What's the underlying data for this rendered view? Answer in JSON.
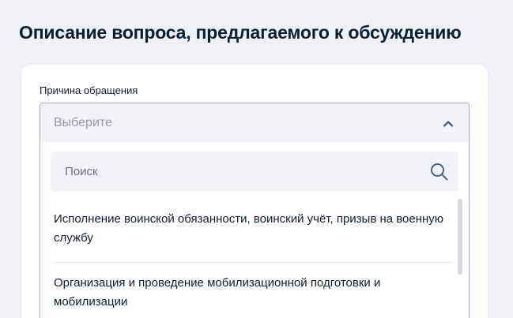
{
  "page": {
    "title": "Описание вопроса, предлагаемого к обсуждению"
  },
  "form": {
    "reason_label": "Причина обращения",
    "select_placeholder": "Выберите",
    "search_placeholder": "Поиск",
    "options": [
      "Исполнение воинской обязанности, воинский учёт, призыв на военную службу",
      "Организация и проведение мобилизационной подготовки и мобилизации"
    ]
  },
  "icons": {
    "collapse": "chevron-up-icon",
    "search": "search-icon"
  },
  "colors": {
    "text": "#0b1f33",
    "placeholder": "#8e9aab",
    "border_focus": "#9db0d8",
    "icon": "#3a5686",
    "field_bg": "#f1f3f8"
  }
}
